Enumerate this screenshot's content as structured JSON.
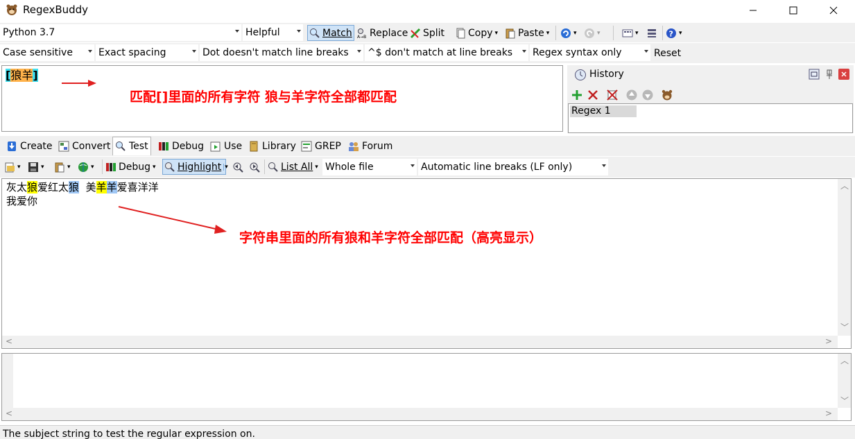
{
  "window": {
    "title": "RegexBuddy"
  },
  "toolbar1": {
    "flavor": "Python 3.7",
    "helpfulness": "Helpful",
    "match_label": "Match",
    "replace_label": "Replace",
    "split_label": "Split",
    "copy_label": "Copy",
    "paste_label": "Paste"
  },
  "toolbar2": {
    "case": "Case sensitive",
    "spacing": "Exact spacing",
    "dot": "Dot doesn't match line breaks",
    "anchors": "^$ don't match at line breaks",
    "syntax": "Regex syntax only",
    "reset_label": "Reset"
  },
  "regex": {
    "open_bracket": "[",
    "chars": "狼羊",
    "close_bracket": "]"
  },
  "annotations": {
    "regex_note": "匹配[]里面的所有字符 狼与羊字符全部都匹配",
    "subject_note": "字符串里面的所有狼和羊字符全部匹配（高亮显示）"
  },
  "history": {
    "title": "History",
    "items": [
      "Regex 1"
    ]
  },
  "tabs": [
    "Create",
    "Convert",
    "Test",
    "Debug",
    "Use",
    "Library",
    "GREP",
    "Forum"
  ],
  "testbar": {
    "debug_label": "Debug",
    "highlight_label": "Highlight",
    "list_all_label": "List All",
    "scope": "Whole file",
    "line_breaks": "Automatic line breaks (LF only)"
  },
  "subject": {
    "line1": [
      {
        "t": "灰太",
        "hl": ""
      },
      {
        "t": "狼",
        "hl": "y"
      },
      {
        "t": "爱红太",
        "hl": ""
      },
      {
        "t": "狼",
        "hl": "b"
      },
      {
        "t": "  美",
        "hl": ""
      },
      {
        "t": "羊",
        "hl": "y"
      },
      {
        "t": "羊",
        "hl": "b"
      },
      {
        "t": "爱喜洋洋",
        "hl": ""
      }
    ],
    "line2": "我爱你"
  },
  "status": {
    "text": "The subject string to test the regular expression on."
  },
  "colors": {
    "match1": "#ffff00",
    "match2": "#9fc7f5",
    "annotation": "#ff0000"
  }
}
